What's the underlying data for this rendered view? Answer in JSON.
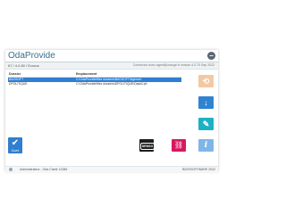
{
  "window": {
    "title": "OdaProvide",
    "close_glyph": "−"
  },
  "subbar": {
    "crumb": "67 / 4.0.80 / Ecrans",
    "hint": "Connexion avec agent@orange.fr version 4.0.70 Sep 2022"
  },
  "grid": {
    "headers": [
      "Dossier",
      "Emplacement"
    ],
    "rows": [
      {
        "name": "BAOSOFT",
        "path": "C:\\OdaProvide\\files dossiers\\BAOSOFT\\Agence\\"
      },
      {
        "name": "DPOLITIQUE",
        "path": "C:\\OdaProvide\\files dossiers\\DPOLITIQUE\\Data\\Cpt\\"
      }
    ],
    "selected_index": 0
  },
  "buttons": {
    "ok_label": "Ouvrir",
    "ok_icon": "check-icon",
    "logo_text": "DENSO",
    "sync_icon": "sync-icon",
    "download_icon": "download-arrow-icon",
    "tools_icon": "wrench-icon",
    "info_icon": "info-icon",
    "link_icon": "chain-link-icon"
  },
  "status": {
    "user": "Administrateur - Oda Clarté 12286",
    "brand": "BIOSSOFTWARE 2022"
  },
  "colors": {
    "title": "#3a6d8f",
    "selection": "#2e7fd3",
    "ok_button": "#2f7fd0",
    "sync_button": "#f2c9a3",
    "download_button": "#2f83d1",
    "tools_button": "#1fb0c4",
    "info_button": "#7fb6e8",
    "link_button": "#d6185f"
  }
}
